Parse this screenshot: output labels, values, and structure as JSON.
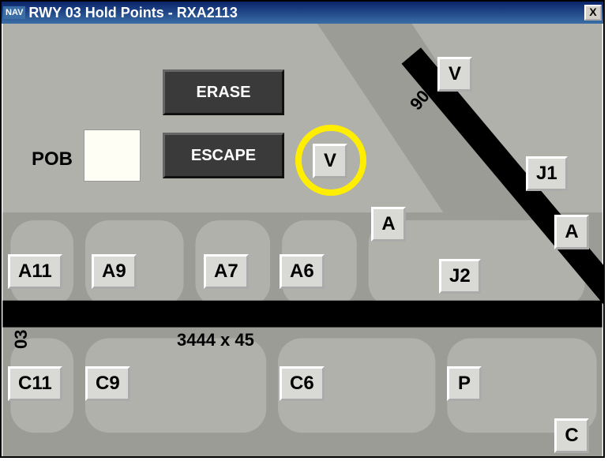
{
  "window": {
    "nav_badge": "NAV",
    "title": "RWY 03 Hold Points - RXA2113",
    "close": "X"
  },
  "controls": {
    "erase": "ERASE",
    "escape": "ESCAPE",
    "pob_label": "POB",
    "pob_value": ""
  },
  "runway": {
    "dimensions": "3444 x 45",
    "end_label": "03",
    "cross_label": "90"
  },
  "holdpoints": {
    "V_top": "V",
    "V_mid": "V",
    "J1": "J1",
    "A_mid": "A",
    "A_right": "A",
    "A11": "A11",
    "A9": "A9",
    "A7": "A7",
    "A6": "A6",
    "J2": "J2",
    "C11": "C11",
    "C9": "C9",
    "C6": "C6",
    "P": "P",
    "C": "C"
  }
}
